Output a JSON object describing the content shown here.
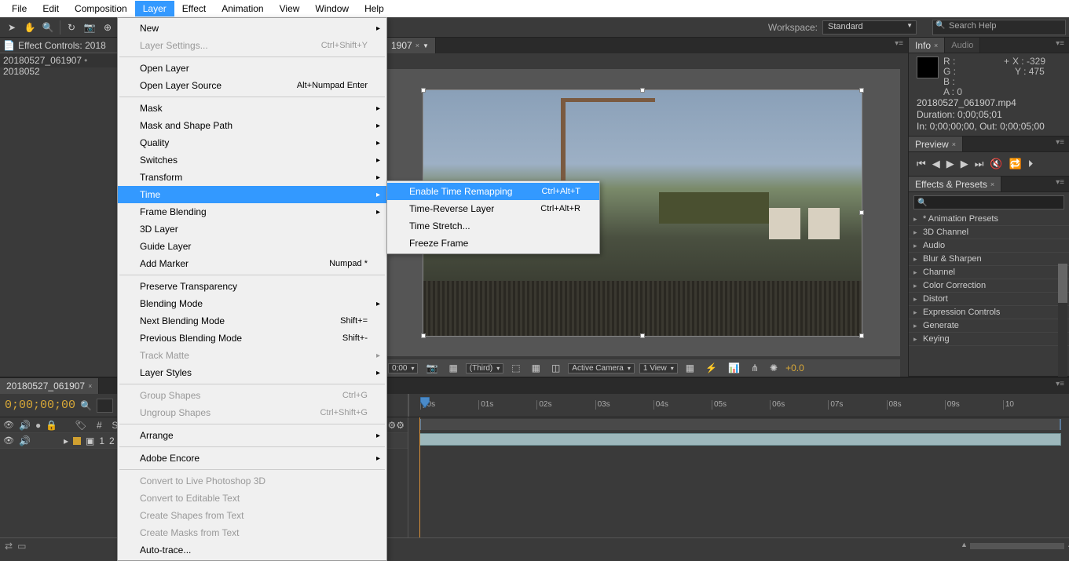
{
  "menubar": [
    "File",
    "Edit",
    "Composition",
    "Layer",
    "Effect",
    "Animation",
    "View",
    "Window",
    "Help"
  ],
  "menubar_active_index": 3,
  "toolbar": {
    "workspace_label": "Workspace:",
    "workspace_value": "Standard",
    "search_placeholder": "Search Help"
  },
  "left": {
    "effect_controls_tab": "Effect Controls: 2018",
    "breadcrumb_a": "20180527_061907",
    "breadcrumb_b": "2018052"
  },
  "comp": {
    "tab": "1907",
    "zoom": "0;00",
    "res": "(Third)",
    "camera": "Active Camera",
    "view": "1 View",
    "exposure": "+0.0"
  },
  "dropdown": [
    {
      "label": "New",
      "sub": true
    },
    {
      "label": "Layer Settings...",
      "shortcut": "Ctrl+Shift+Y",
      "disabled": true
    },
    {
      "sep": true
    },
    {
      "label": "Open Layer"
    },
    {
      "label": "Open Layer Source",
      "shortcut": "Alt+Numpad Enter"
    },
    {
      "sep": true
    },
    {
      "label": "Mask",
      "sub": true
    },
    {
      "label": "Mask and Shape Path",
      "sub": true
    },
    {
      "label": "Quality",
      "sub": true
    },
    {
      "label": "Switches",
      "sub": true
    },
    {
      "label": "Transform",
      "sub": true
    },
    {
      "label": "Time",
      "sub": true,
      "highlight": true
    },
    {
      "label": "Frame Blending",
      "sub": true
    },
    {
      "label": "3D Layer"
    },
    {
      "label": "Guide Layer"
    },
    {
      "label": "Add Marker",
      "shortcut": "Numpad *"
    },
    {
      "sep": true
    },
    {
      "label": "Preserve Transparency"
    },
    {
      "label": "Blending Mode",
      "sub": true
    },
    {
      "label": "Next Blending Mode",
      "shortcut": "Shift+="
    },
    {
      "label": "Previous Blending Mode",
      "shortcut": "Shift+-"
    },
    {
      "label": "Track Matte",
      "sub": true,
      "disabled": true
    },
    {
      "label": "Layer Styles",
      "sub": true
    },
    {
      "sep": true
    },
    {
      "label": "Group Shapes",
      "shortcut": "Ctrl+G",
      "disabled": true
    },
    {
      "label": "Ungroup Shapes",
      "shortcut": "Ctrl+Shift+G",
      "disabled": true
    },
    {
      "sep": true
    },
    {
      "label": "Arrange",
      "sub": true
    },
    {
      "sep": true
    },
    {
      "label": "Adobe Encore",
      "sub": true
    },
    {
      "sep": true
    },
    {
      "label": "Convert to Live Photoshop 3D",
      "disabled": true
    },
    {
      "label": "Convert to Editable Text",
      "disabled": true
    },
    {
      "label": "Create Shapes from Text",
      "disabled": true
    },
    {
      "label": "Create Masks from Text",
      "disabled": true
    },
    {
      "label": "Auto-trace..."
    }
  ],
  "submenu": [
    {
      "label": "Enable Time Remapping",
      "shortcut": "Ctrl+Alt+T",
      "highlight": true
    },
    {
      "label": "Time-Reverse Layer",
      "shortcut": "Ctrl+Alt+R"
    },
    {
      "label": "Time Stretch..."
    },
    {
      "label": "Freeze Frame"
    }
  ],
  "info": {
    "tab1": "Info",
    "tab2": "Audio",
    "r": "R :",
    "g": "G :",
    "b": "B :",
    "a": "A :  0",
    "x": "X : -329",
    "y": "Y : 475",
    "file": "20180527_061907.mp4",
    "duration": "Duration: 0;00;05;01",
    "inout": "In: 0;00;00;00, Out: 0;00;05;00"
  },
  "preview": {
    "tab": "Preview"
  },
  "effects_presets": {
    "tab": "Effects & Presets",
    "items": [
      {
        "label": "* Animation Presets"
      },
      {
        "label": "3D Channel"
      },
      {
        "label": "Audio"
      },
      {
        "label": "Blur & Sharpen"
      },
      {
        "label": "Channel"
      },
      {
        "label": "Color Correction"
      },
      {
        "label": "Distort"
      },
      {
        "label": "Expression Controls"
      },
      {
        "label": "Generate"
      },
      {
        "label": "Keying"
      }
    ]
  },
  "timeline": {
    "tab": "20180527_061907",
    "timecode": "0;00;00;00",
    "header_num": "#",
    "header_name": "Source Name",
    "layer_num": "1",
    "layer_name": "2",
    "ticks": [
      "p0s",
      "01s",
      "02s",
      "03s",
      "04s",
      "05s",
      "06s",
      "07s",
      "08s",
      "09s",
      "10"
    ]
  }
}
